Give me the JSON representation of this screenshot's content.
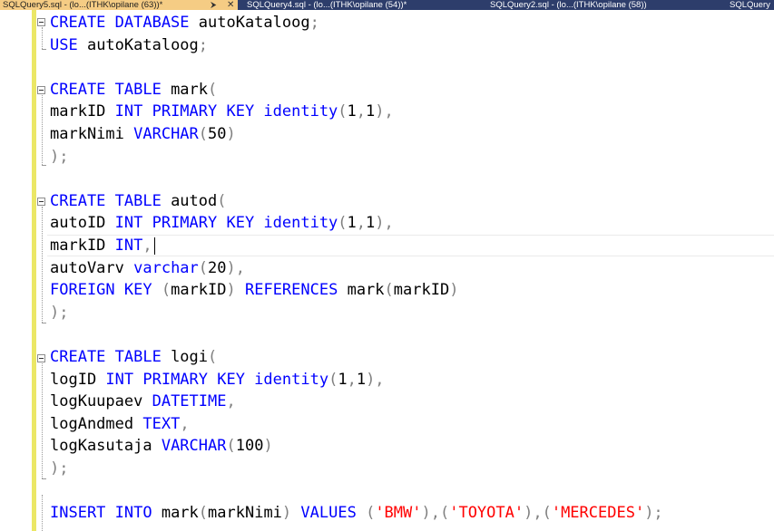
{
  "tabs": [
    {
      "label": "SQLQuery5.sql - (lo...(ITHK\\opilane (63))*",
      "active": true
    },
    {
      "label": "SQLQuery4.sql - (lo...(ITHK\\opilane (54))*",
      "active": false
    },
    {
      "label": "SQLQuery2.sql - (lo...(ITHK\\opilane (58))",
      "active": false
    },
    {
      "label": "SQLQuery",
      "active": false
    }
  ],
  "tab_icons": {
    "pin": "pin-icon",
    "close": "close-icon"
  },
  "editor": {
    "lines": [
      [
        {
          "t": "CREATE DATABASE",
          "c": "kw"
        },
        {
          "t": " autoKataloog",
          "c": ""
        },
        {
          "t": ";",
          "c": "gr"
        }
      ],
      [
        {
          "t": "USE",
          "c": "kw"
        },
        {
          "t": " autoKataloog",
          "c": ""
        },
        {
          "t": ";",
          "c": "gr"
        }
      ],
      [],
      [
        {
          "t": "CREATE TABLE",
          "c": "kw"
        },
        {
          "t": " mark",
          "c": ""
        },
        {
          "t": "(",
          "c": "gr"
        }
      ],
      [
        {
          "t": "markID ",
          "c": ""
        },
        {
          "t": "INT PRIMARY KEY identity",
          "c": "kw"
        },
        {
          "t": "(",
          "c": "gr"
        },
        {
          "t": "1",
          "c": ""
        },
        {
          "t": ",",
          "c": "gr"
        },
        {
          "t": "1",
          "c": ""
        },
        {
          "t": "),",
          "c": "gr"
        }
      ],
      [
        {
          "t": "markNimi ",
          "c": ""
        },
        {
          "t": "VARCHAR",
          "c": "kw"
        },
        {
          "t": "(",
          "c": "gr"
        },
        {
          "t": "50",
          "c": ""
        },
        {
          "t": ")",
          "c": "gr"
        }
      ],
      [
        {
          "t": ");",
          "c": "gr"
        }
      ],
      [],
      [
        {
          "t": "CREATE TABLE",
          "c": "kw"
        },
        {
          "t": " autod",
          "c": ""
        },
        {
          "t": "(",
          "c": "gr"
        }
      ],
      [
        {
          "t": "autoID ",
          "c": ""
        },
        {
          "t": "INT PRIMARY KEY identity",
          "c": "kw"
        },
        {
          "t": "(",
          "c": "gr"
        },
        {
          "t": "1",
          "c": ""
        },
        {
          "t": ",",
          "c": "gr"
        },
        {
          "t": "1",
          "c": ""
        },
        {
          "t": "),",
          "c": "gr"
        }
      ],
      [
        {
          "t": "markID ",
          "c": ""
        },
        {
          "t": "INT",
          "c": "kw"
        },
        {
          "t": ",",
          "c": "gr"
        }
      ],
      [
        {
          "t": "autoVarv ",
          "c": ""
        },
        {
          "t": "varchar",
          "c": "kw"
        },
        {
          "t": "(",
          "c": "gr"
        },
        {
          "t": "20",
          "c": ""
        },
        {
          "t": "),",
          "c": "gr"
        }
      ],
      [
        {
          "t": "FOREIGN KEY",
          "c": "kw"
        },
        {
          "t": " (",
          "c": "gr"
        },
        {
          "t": "markID",
          "c": ""
        },
        {
          "t": ")",
          "c": "gr"
        },
        {
          "t": " REFERENCES",
          "c": "kw"
        },
        {
          "t": " mark",
          "c": ""
        },
        {
          "t": "(",
          "c": "gr"
        },
        {
          "t": "markID",
          "c": ""
        },
        {
          "t": ")",
          "c": "gr"
        }
      ],
      [
        {
          "t": ");",
          "c": "gr"
        }
      ],
      [],
      [
        {
          "t": "CREATE TABLE",
          "c": "kw"
        },
        {
          "t": " logi",
          "c": ""
        },
        {
          "t": "(",
          "c": "gr"
        }
      ],
      [
        {
          "t": "logID ",
          "c": ""
        },
        {
          "t": "INT PRIMARY KEY identity",
          "c": "kw"
        },
        {
          "t": "(",
          "c": "gr"
        },
        {
          "t": "1",
          "c": ""
        },
        {
          "t": ",",
          "c": "gr"
        },
        {
          "t": "1",
          "c": ""
        },
        {
          "t": "),",
          "c": "gr"
        }
      ],
      [
        {
          "t": "logKuupaev ",
          "c": ""
        },
        {
          "t": "DATETIME",
          "c": "kw"
        },
        {
          "t": ",",
          "c": "gr"
        }
      ],
      [
        {
          "t": "logAndmed ",
          "c": ""
        },
        {
          "t": "TEXT",
          "c": "kw"
        },
        {
          "t": ",",
          "c": "gr"
        }
      ],
      [
        {
          "t": "logKasutaja ",
          "c": ""
        },
        {
          "t": "VARCHAR",
          "c": "kw"
        },
        {
          "t": "(",
          "c": "gr"
        },
        {
          "t": "100",
          "c": ""
        },
        {
          "t": ")",
          "c": "gr"
        }
      ],
      [
        {
          "t": ");",
          "c": "gr"
        }
      ],
      [],
      [
        {
          "t": "INSERT INTO",
          "c": "kw"
        },
        {
          "t": " mark",
          "c": ""
        },
        {
          "t": "(",
          "c": "gr"
        },
        {
          "t": "markNimi",
          "c": ""
        },
        {
          "t": ")",
          "c": "gr"
        },
        {
          "t": " VALUES",
          "c": "kw"
        },
        {
          "t": " (",
          "c": "gr"
        },
        {
          "t": "'BMW'",
          "c": "st"
        },
        {
          "t": "),(",
          "c": "gr"
        },
        {
          "t": "'TOYOTA'",
          "c": "st"
        },
        {
          "t": "),(",
          "c": "gr"
        },
        {
          "t": "'MERCEDES'",
          "c": "st"
        },
        {
          "t": ");",
          "c": "gr"
        }
      ]
    ]
  },
  "colors": {
    "keyword": "#0000ff",
    "punctuation": "#808080",
    "string": "#ff0000",
    "active_tab": "#f5cc84",
    "tab_bar": "#2d3d6b",
    "change_bar": "#ebe766"
  }
}
